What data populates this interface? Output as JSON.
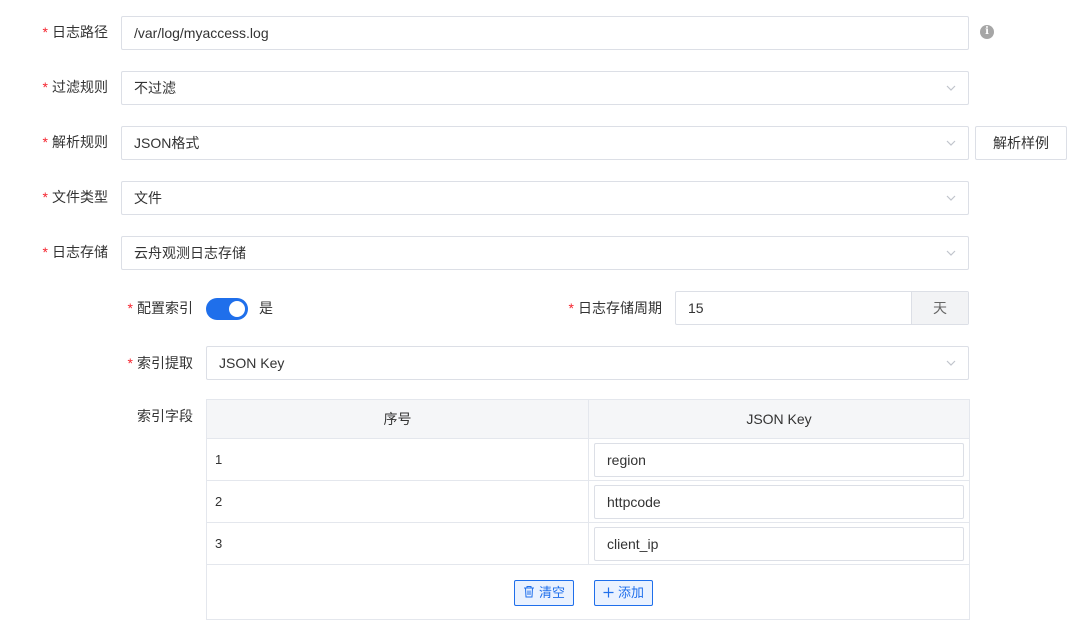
{
  "form": {
    "log_path": {
      "label": "日志路径",
      "value": "/var/log/myaccess.log"
    },
    "filter_rule": {
      "label": "过滤规则",
      "value": "不过滤"
    },
    "parse_rule": {
      "label": "解析规则",
      "value": "JSON格式",
      "sample_button": "解析样例"
    },
    "file_type": {
      "label": "文件类型",
      "value": "文件"
    },
    "log_storage": {
      "label": "日志存储",
      "value": "云舟观测日志存储"
    },
    "config_index": {
      "label": "配置索引",
      "enabled": true,
      "state_text": "是"
    },
    "storage_period": {
      "label": "日志存储周期",
      "value": "15",
      "unit": "天"
    },
    "index_extract": {
      "label": "索引提取",
      "value": "JSON Key"
    },
    "index_fields": {
      "label": "索引字段",
      "columns": [
        "序号",
        "JSON Key"
      ],
      "rows": [
        {
          "index": "1",
          "key": "region"
        },
        {
          "index": "2",
          "key": "httpcode"
        },
        {
          "index": "3",
          "key": "client_ip"
        }
      ],
      "clear_button": "清空",
      "add_button": "添加"
    }
  },
  "required_mark": "*",
  "info_icon": "i",
  "colors": {
    "accent": "#1f6feb",
    "required": "#f5222d",
    "border": "#dcdfe6",
    "header_bg": "#f5f6f8"
  }
}
